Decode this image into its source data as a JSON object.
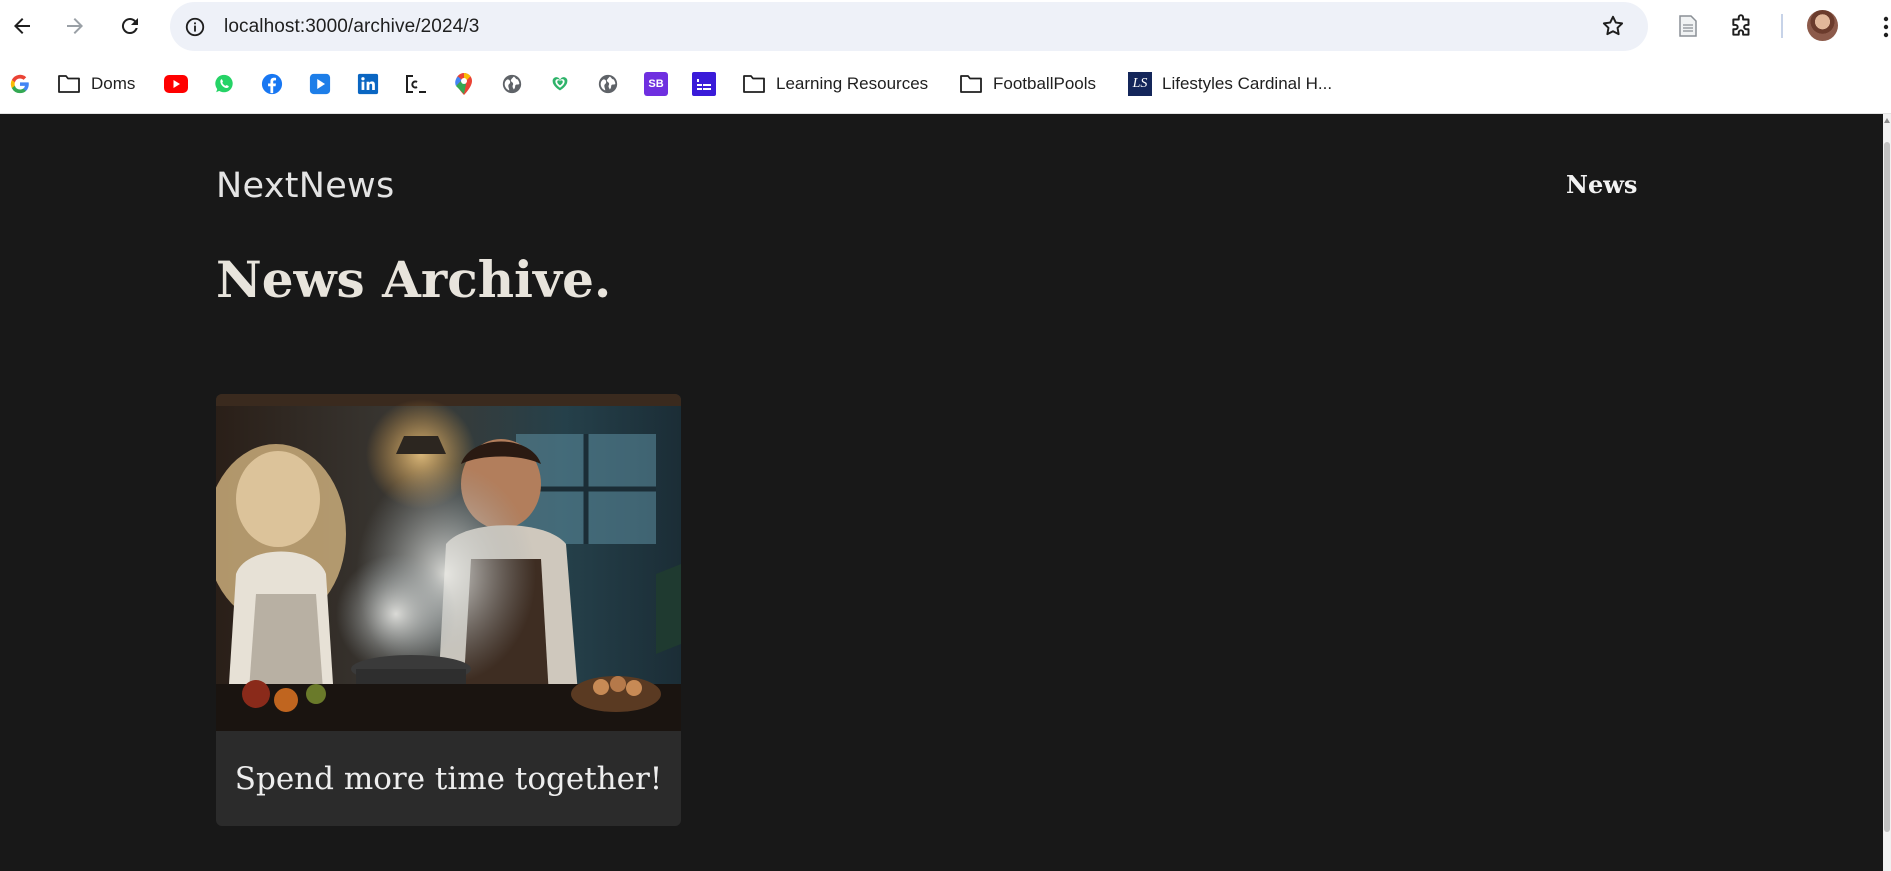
{
  "browser": {
    "url": "localhost:3000/archive/2024/3",
    "bookmarks": [
      {
        "label": "",
        "icon": "google-icon"
      },
      {
        "label": "Doms",
        "icon": "folder-icon"
      },
      {
        "label": "",
        "icon": "youtube-icon"
      },
      {
        "label": "",
        "icon": "whatsapp-icon"
      },
      {
        "label": "",
        "icon": "facebook-icon"
      },
      {
        "label": "",
        "icon": "play-icon"
      },
      {
        "label": "",
        "icon": "linkedin-icon"
      },
      {
        "label": "",
        "icon": "course-icon"
      },
      {
        "label": "",
        "icon": "maps-icon"
      },
      {
        "label": "",
        "icon": "globe-icon"
      },
      {
        "label": "",
        "icon": "heart-shield-icon"
      },
      {
        "label": "",
        "icon": "globe-icon"
      },
      {
        "label": "",
        "icon": "sb-icon"
      },
      {
        "label": "",
        "icon": "calendar-icon"
      },
      {
        "label": "Learning Resources",
        "icon": "folder-icon"
      },
      {
        "label": "FootballPools",
        "icon": "folder-icon"
      },
      {
        "label": "Lifestyles Cardinal H...",
        "icon": "ls-icon"
      }
    ],
    "sb_text": "SB",
    "ls_text": "LS"
  },
  "site": {
    "logo": "NextNews",
    "nav": {
      "news": "News"
    },
    "page_title": "News Archive.",
    "articles": [
      {
        "title": "Spend more time together!"
      }
    ]
  }
}
